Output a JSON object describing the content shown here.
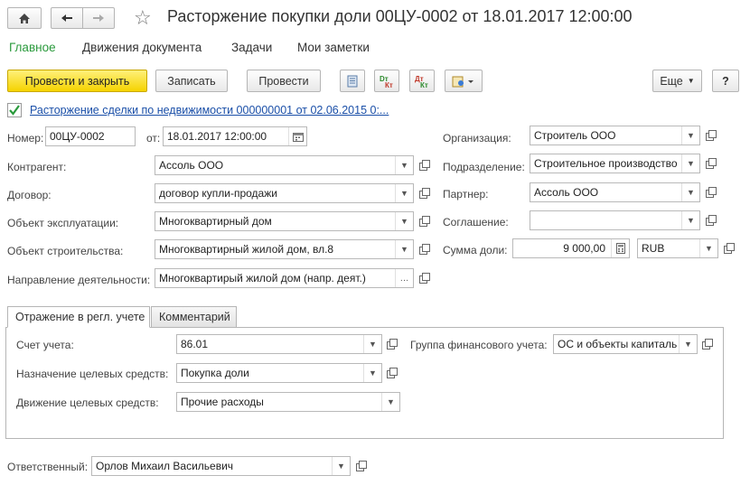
{
  "window": {
    "title": "Расторжение покупки доли 00ЦУ-0002 от 18.01.2017 12:00:00"
  },
  "nav": {
    "home_icon": "home-icon",
    "back_icon": "arrow-left-icon",
    "forward_icon": "arrow-right-icon",
    "star_icon": "star-icon"
  },
  "menu": {
    "main": "Главное",
    "movements": "Движения документа",
    "tasks": "Задачи",
    "notes": "Мои заметки"
  },
  "toolbar": {
    "post_close": "Провести и закрыть",
    "save": "Записать",
    "post": "Провести",
    "more": "Еще",
    "help": "?"
  },
  "basis": {
    "checked": true,
    "link": "Расторжение сделки по недвижимости 000000001 от 02.06.2015 0:..."
  },
  "form": {
    "number_label": "Номер:",
    "number": "00ЦУ-0002",
    "date_label": "от:",
    "date": "18.01.2017 12:00:00",
    "org_label": "Организация:",
    "org": "Строитель ООО",
    "counterparty_label": "Контрагент:",
    "counterparty": "Ассоль ООО",
    "division_label": "Подразделение:",
    "division": "Строительное производство",
    "contract_label": "Договор:",
    "contract": "договор купли-продажи",
    "partner_label": "Партнер:",
    "partner": "Ассоль ООО",
    "object_label": "Объект эксплуатации:",
    "object": "Многоквартирный дом",
    "agreement_label": "Соглашение:",
    "agreement": "",
    "construction_label": "Объект строительства:",
    "construction": "Многоквартирный жилой дом, вл.8",
    "share_label": "Сумма доли:",
    "share": "9 000,00",
    "currency": "RUB",
    "activity_label": "Направление деятельности:",
    "activity": "Многоквартирый жилой дом (напр. деят.)"
  },
  "tabs": {
    "accounting": "Отражение в регл. учете",
    "comment": "Комментарий"
  },
  "accounting": {
    "account_label": "Счет учета:",
    "account": "86.01",
    "fin_group_label": "Группа финансового учета:",
    "fin_group": "ОС и объекты капиталь",
    "purpose_label": "Назначение целевых средств:",
    "purpose": "Покупка доли",
    "movement_label": "Движение целевых средств:",
    "movement": "Прочие расходы"
  },
  "responsible": {
    "label": "Ответственный:",
    "value": "Орлов Михаил Васильевич"
  }
}
